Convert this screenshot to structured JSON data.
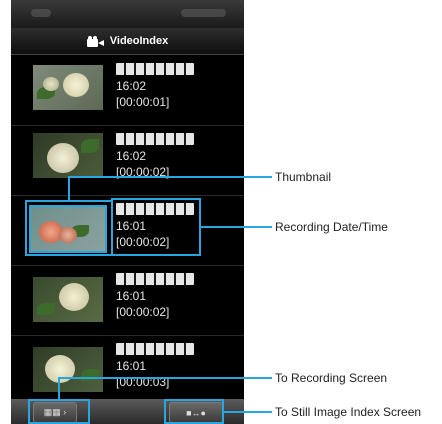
{
  "app": {
    "title": "VideoIndex"
  },
  "items": [
    {
      "time": "16:02",
      "duration": "[00:00:01]"
    },
    {
      "time": "16:02",
      "duration": "[00:00:02]"
    },
    {
      "time": "16:01",
      "duration": "[00:00:02]"
    },
    {
      "time": "16:01",
      "duration": "[00:00:02]"
    },
    {
      "time": "16:01",
      "duration": "[00:00:03]"
    }
  ],
  "callouts": {
    "thumbnail": "Thumbnail",
    "recording_datetime": "Recording Date/Time",
    "to_recording": "To Recording Screen",
    "to_still_index": "To Still Image Index Screen"
  },
  "colors": {
    "highlight": "#2aa6de",
    "background": "#000000",
    "text": "#e6e6e6"
  },
  "icons": [
    "video-camera-icon",
    "grid-index-icon",
    "camera-switch-icon"
  ]
}
